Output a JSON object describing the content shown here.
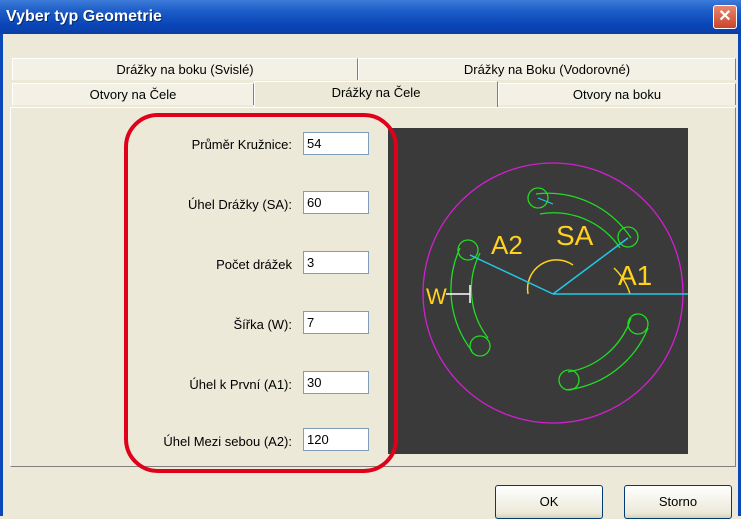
{
  "window": {
    "title": "Vyber typ Geometrie",
    "close_symbol": "✕"
  },
  "tabs": {
    "row1": [
      {
        "label": "Drážky na boku (Svislé)"
      },
      {
        "label": "Drážky na Boku (Vodorovné)"
      }
    ],
    "row2": [
      {
        "label": "Otvory na Čele"
      },
      {
        "label": "Drážky na Čele",
        "active": true
      },
      {
        "label": "Otvory na boku"
      }
    ]
  },
  "form": {
    "fields": [
      {
        "label": "Průměr Kružnice:",
        "value": "54"
      },
      {
        "label": "Úhel Drážky (SA):",
        "value": "60"
      },
      {
        "label": "Počet drážek",
        "value": "3"
      },
      {
        "label": "Šířka (W):",
        "value": "7"
      },
      {
        "label": "Úhel k První (A1):",
        "value": "30"
      },
      {
        "label": "Úhel Mezi sebou (A2):",
        "value": "120"
      }
    ]
  },
  "preview": {
    "labels": {
      "sa": "SA",
      "a1": "A1",
      "a2": "A2",
      "w": "W"
    },
    "colors": {
      "background": "#3a3a3a",
      "outer_circle": "#d21fd2",
      "slots": "#22dd22",
      "dimension": "#ffd21e",
      "axes": "#22c8e6"
    }
  },
  "buttons": {
    "ok": "OK",
    "cancel": "Storno"
  }
}
